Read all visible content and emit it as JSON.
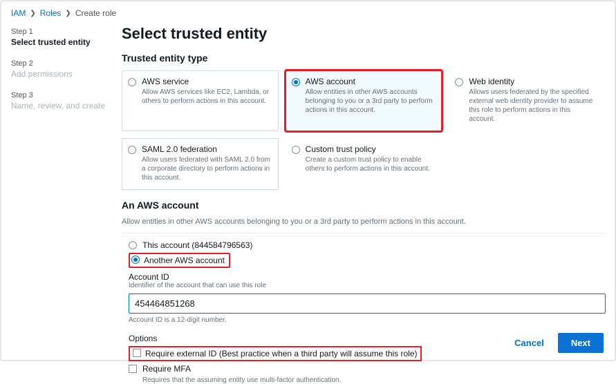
{
  "breadcrumb": {
    "iam": "IAM",
    "roles": "Roles",
    "create": "Create role"
  },
  "steps": {
    "s1_label": "Step 1",
    "s1_title": "Select trusted entity",
    "s2_label": "Step 2",
    "s2_title": "Add permissions",
    "s3_label": "Step 3",
    "s3_title": "Name, review, and create"
  },
  "page_title": "Select trusted entity",
  "section_entity_type": "Trusted entity type",
  "cards": {
    "aws_service": {
      "title": "AWS service",
      "desc": "Allow AWS services like EC2, Lambda, or others to perform actions in this account."
    },
    "aws_account": {
      "title": "AWS account",
      "desc": "Allow entities in other AWS accounts belonging to you or a 3rd party to perform actions in this account."
    },
    "web_identity": {
      "title": "Web identity",
      "desc": "Allows users federated by the specified external web identity provider to assume this role to perform actions in this account."
    },
    "saml": {
      "title": "SAML 2.0 federation",
      "desc": "Allow users federated with SAML 2.0 from a corporate directory to perform actions in this account."
    },
    "custom": {
      "title": "Custom trust policy",
      "desc": "Create a custom trust policy to enable others to perform actions in this account."
    }
  },
  "account_section": {
    "heading": "An AWS account",
    "sub": "Allow entities in other AWS accounts belonging to you or a 3rd party to perform actions in this account.",
    "this_account": "This account (844584796563)",
    "another": "Another AWS account",
    "account_id_label": "Account ID",
    "account_id_help": "Identifier of the account that can use this role",
    "account_id_value": "454464851268",
    "account_id_hint": "Account ID is a 12-digit number."
  },
  "options": {
    "heading": "Options",
    "ext_id": "Require external ID (Best practice when a third party will assume this role)",
    "mfa": "Require MFA",
    "mfa_help": "Requires that the assuming entity use multi-factor authentication."
  },
  "buttons": {
    "cancel": "Cancel",
    "next": "Next"
  }
}
